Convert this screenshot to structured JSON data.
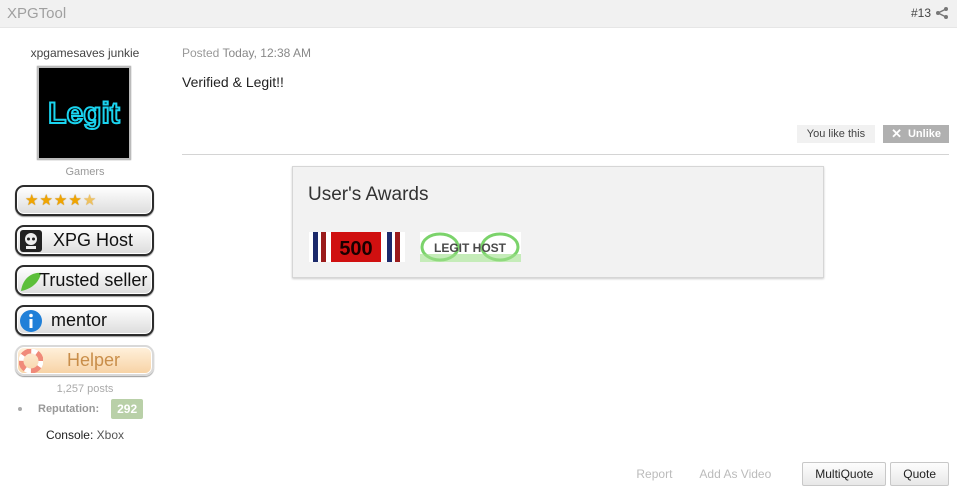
{
  "header": {
    "username": "XPGTool",
    "post_number": "#13",
    "share_icon": "share-icon"
  },
  "sidebar": {
    "member_title": "xpgamesaves junkie",
    "avatar_text": "Legit",
    "group": "Gamers",
    "badges": [
      "XPG Host",
      "Trusted seller",
      "mentor",
      "Helper"
    ],
    "rating_stars": 4.5,
    "posts": "1,257 posts",
    "reputation_label": "Reputation:",
    "reputation_value": "292",
    "console_label": "Console:",
    "console_value": "Xbox"
  },
  "post": {
    "posted_label": "Posted",
    "posted_time": "Today, 12:38 AM",
    "body": "Verified & Legit!!",
    "you_like": "You like this",
    "unlike": "Unlike"
  },
  "awards": {
    "title": "User's Awards",
    "items": [
      {
        "label": "500"
      },
      {
        "label": "LEGIT HOST"
      }
    ]
  },
  "actions": {
    "report": "Report",
    "add_video": "Add As Video",
    "multiquote": "MultiQuote",
    "quote": "Quote"
  },
  "colors": {
    "reputation_bg": "#b9d0a8",
    "topbar_bg": "#f1f1f1"
  }
}
